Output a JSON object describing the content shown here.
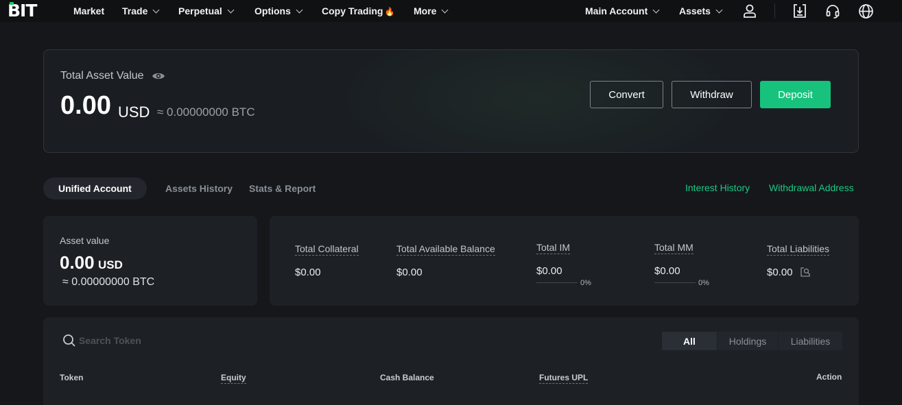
{
  "brand": {
    "logo_text": "BIT",
    "accent": "#17c27d"
  },
  "nav": {
    "items": [
      {
        "label": "Market"
      },
      {
        "label": "Trade"
      },
      {
        "label": "Perpetual"
      },
      {
        "label": "Options"
      },
      {
        "label": "Copy Trading"
      },
      {
        "label": "More"
      }
    ],
    "account_label": "Main Account",
    "assets_label": "Assets",
    "icons": [
      "user-icon",
      "download-app-icon",
      "headset-icon",
      "globe-icon"
    ]
  },
  "total_asset": {
    "label": "Total Asset Value",
    "value": "0.00",
    "currency": "USD",
    "btc": "≈ 0.00000000 BTC",
    "buttons": {
      "convert": "Convert",
      "withdraw": "Withdraw",
      "deposit": "Deposit"
    }
  },
  "tabs": {
    "items": [
      {
        "label": "Unified Account",
        "active": true
      },
      {
        "label": "Assets History",
        "active": false
      },
      {
        "label": "Stats & Report",
        "active": false
      }
    ],
    "links": {
      "interest_history": "Interest History",
      "withdrawal_address": "Withdrawal Address"
    }
  },
  "asset_value": {
    "label": "Asset value",
    "value": "0.00",
    "currency": "USD",
    "btc": "≈ 0.00000000 BTC"
  },
  "metrics": [
    {
      "label": "Total Collateral",
      "value": "$0.00"
    },
    {
      "label": "Total Available Balance",
      "value": "$0.00"
    },
    {
      "label": "Total IM",
      "value": "$0.00",
      "percent": "0%"
    },
    {
      "label": "Total MM",
      "value": "$0.00",
      "percent": "0%"
    },
    {
      "label": "Total Liabilities",
      "value": "$0.00"
    }
  ],
  "token_table": {
    "search_placeholder": "Search Token",
    "filters": [
      {
        "label": "All",
        "active": true
      },
      {
        "label": "Holdings",
        "active": false
      },
      {
        "label": "Liabilities",
        "active": false
      }
    ],
    "columns": [
      "Token",
      "Equity",
      "Cash Balance",
      "Futures UPL",
      "Action"
    ]
  }
}
